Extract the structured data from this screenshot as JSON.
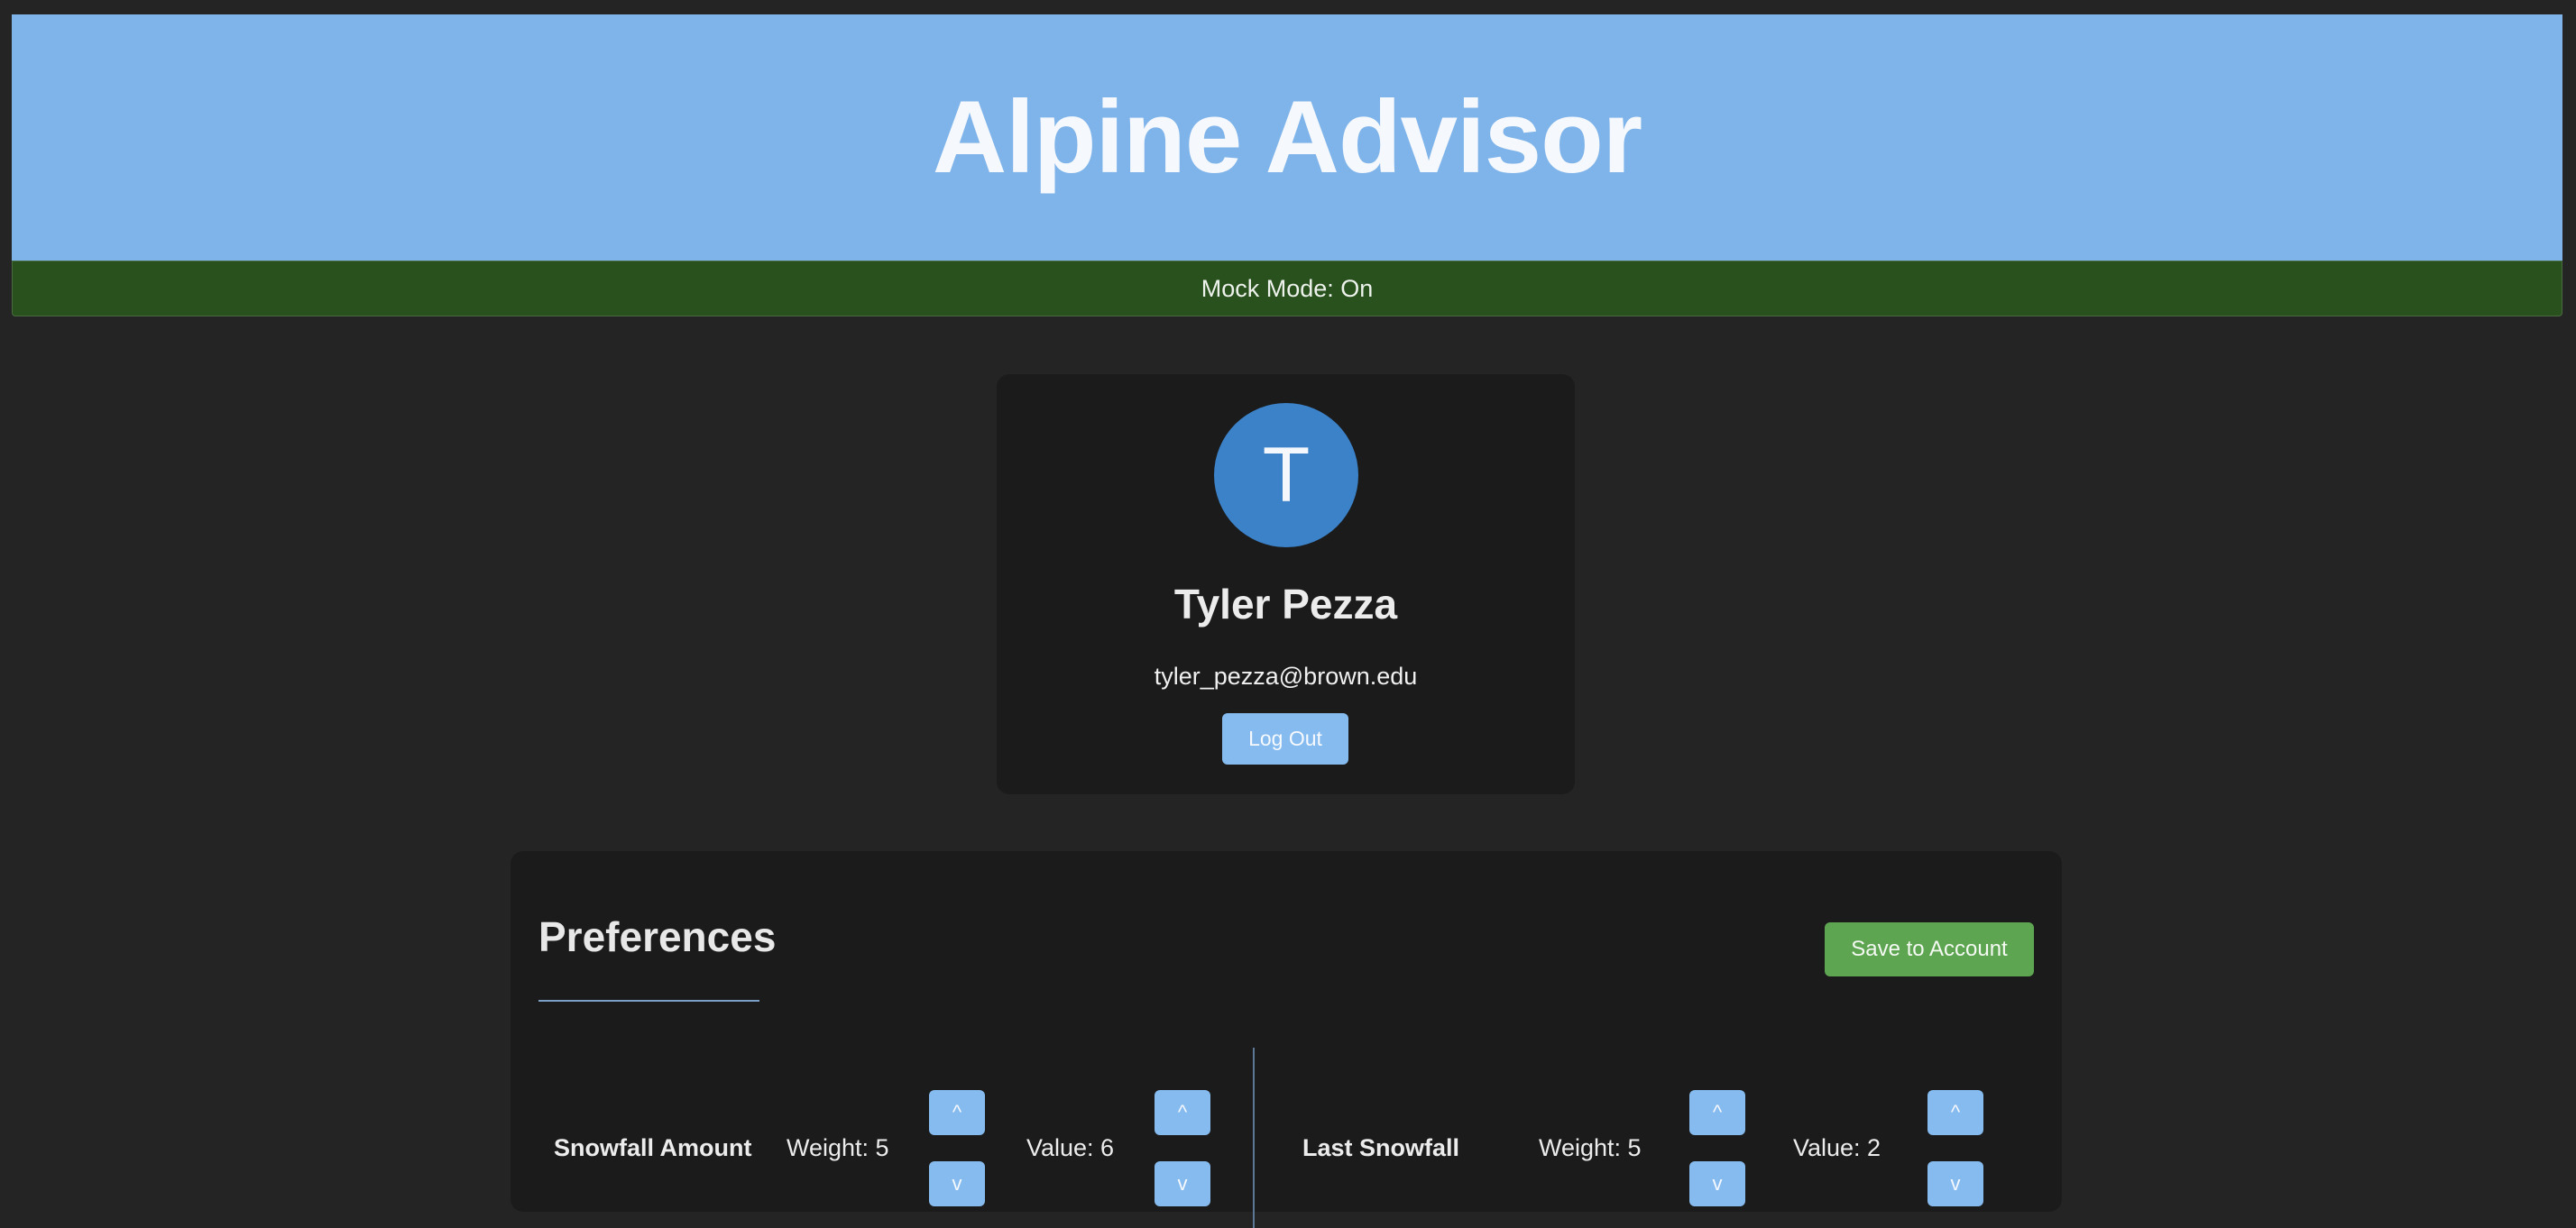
{
  "app": {
    "title": "Alpine Advisor"
  },
  "status": {
    "mock_mode": "Mock Mode: On"
  },
  "profile": {
    "avatar_initial": "T",
    "name": "Tyler Pezza",
    "email": "tyler_pezza@brown.edu",
    "logout_label": "Log Out"
  },
  "preferences": {
    "title": "Preferences",
    "save_label": "Save to Account",
    "items": [
      {
        "label": "Snowfall Amount",
        "weight": "Weight: 5",
        "value": "Value: 6",
        "up": "^",
        "down": "v"
      },
      {
        "label": "Last Snowfall",
        "weight": "Weight: 5",
        "value": "Value: 2",
        "up": "^",
        "down": "v"
      }
    ]
  },
  "colors": {
    "header_bg": "#7fb4ea",
    "mock_bar_bg": "#28511e",
    "avatar_bg": "#3b82c9",
    "button_blue": "#86bbef",
    "button_green": "#5ea552",
    "page_bg": "#242424",
    "card_bg": "#1b1b1b"
  }
}
